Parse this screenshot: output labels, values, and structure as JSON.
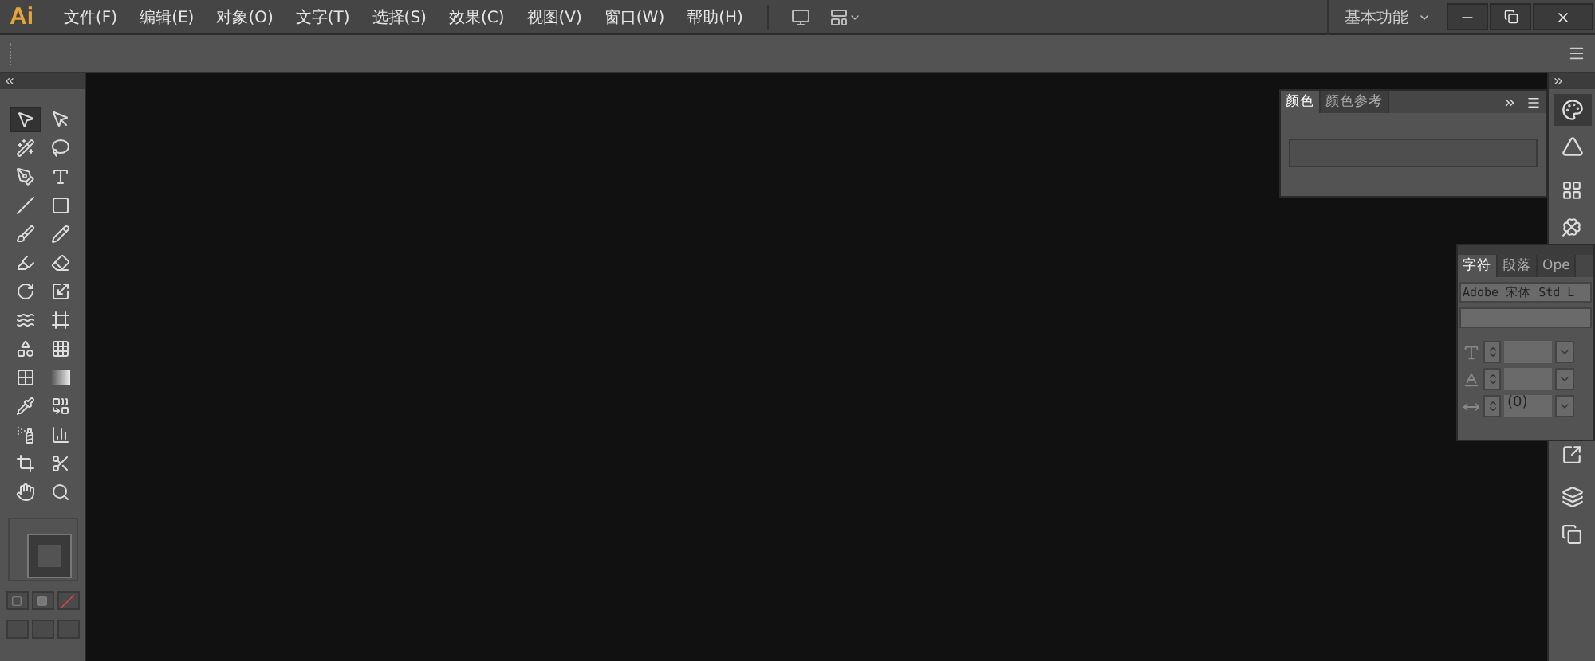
{
  "app": {
    "logo": "Ai"
  },
  "menus": [
    {
      "label": "文件(F)"
    },
    {
      "label": "编辑(E)"
    },
    {
      "label": "对象(O)"
    },
    {
      "label": "文字(T)"
    },
    {
      "label": "选择(S)"
    },
    {
      "label": "效果(C)"
    },
    {
      "label": "视图(V)"
    },
    {
      "label": "窗口(W)"
    },
    {
      "label": "帮助(H)"
    }
  ],
  "workspace": {
    "label": "基本功能"
  },
  "tools": [
    {
      "kind": "selection",
      "selected": true
    },
    {
      "kind": "direct",
      "selected": false
    },
    {
      "kind": "wand",
      "selected": false
    },
    {
      "kind": "lasso",
      "selected": false
    },
    {
      "kind": "pen",
      "selected": false
    },
    {
      "kind": "type",
      "selected": false
    },
    {
      "kind": "line",
      "selected": false
    },
    {
      "kind": "rect",
      "selected": false
    },
    {
      "kind": "brush",
      "selected": false
    },
    {
      "kind": "pencil",
      "selected": false
    },
    {
      "kind": "blob",
      "selected": false
    },
    {
      "kind": "eraser",
      "selected": false
    },
    {
      "kind": "rotate",
      "selected": false
    },
    {
      "kind": "scale",
      "selected": false
    },
    {
      "kind": "warp",
      "selected": false
    },
    {
      "kind": "transform",
      "selected": false
    },
    {
      "kind": "builder",
      "selected": false
    },
    {
      "kind": "perspective",
      "selected": false
    },
    {
      "kind": "mesh",
      "selected": false
    },
    {
      "kind": "gradient",
      "selected": false
    },
    {
      "kind": "eyedropper",
      "selected": false
    },
    {
      "kind": "blend",
      "selected": false
    },
    {
      "kind": "spray",
      "selected": false
    },
    {
      "kind": "graph",
      "selected": false
    },
    {
      "kind": "artboard",
      "selected": false
    },
    {
      "kind": "slice",
      "selected": false
    },
    {
      "kind": "hand",
      "selected": false
    },
    {
      "kind": "zoom",
      "selected": false
    }
  ],
  "color_panel": {
    "tabs": [
      {
        "label": "颜色",
        "selected": true
      },
      {
        "label": "颜色参考",
        "selected": false
      }
    ]
  },
  "character_panel": {
    "tabs": [
      {
        "label": "字符",
        "selected": true
      },
      {
        "label": "段落",
        "selected": false
      },
      {
        "label": "Ope",
        "selected": false
      }
    ],
    "font": "Adobe 宋体 Std L",
    "fields": [
      {
        "kind": "size"
      },
      {
        "kind": "leading"
      },
      {
        "kind": "kerning",
        "value": "(0)"
      }
    ]
  }
}
